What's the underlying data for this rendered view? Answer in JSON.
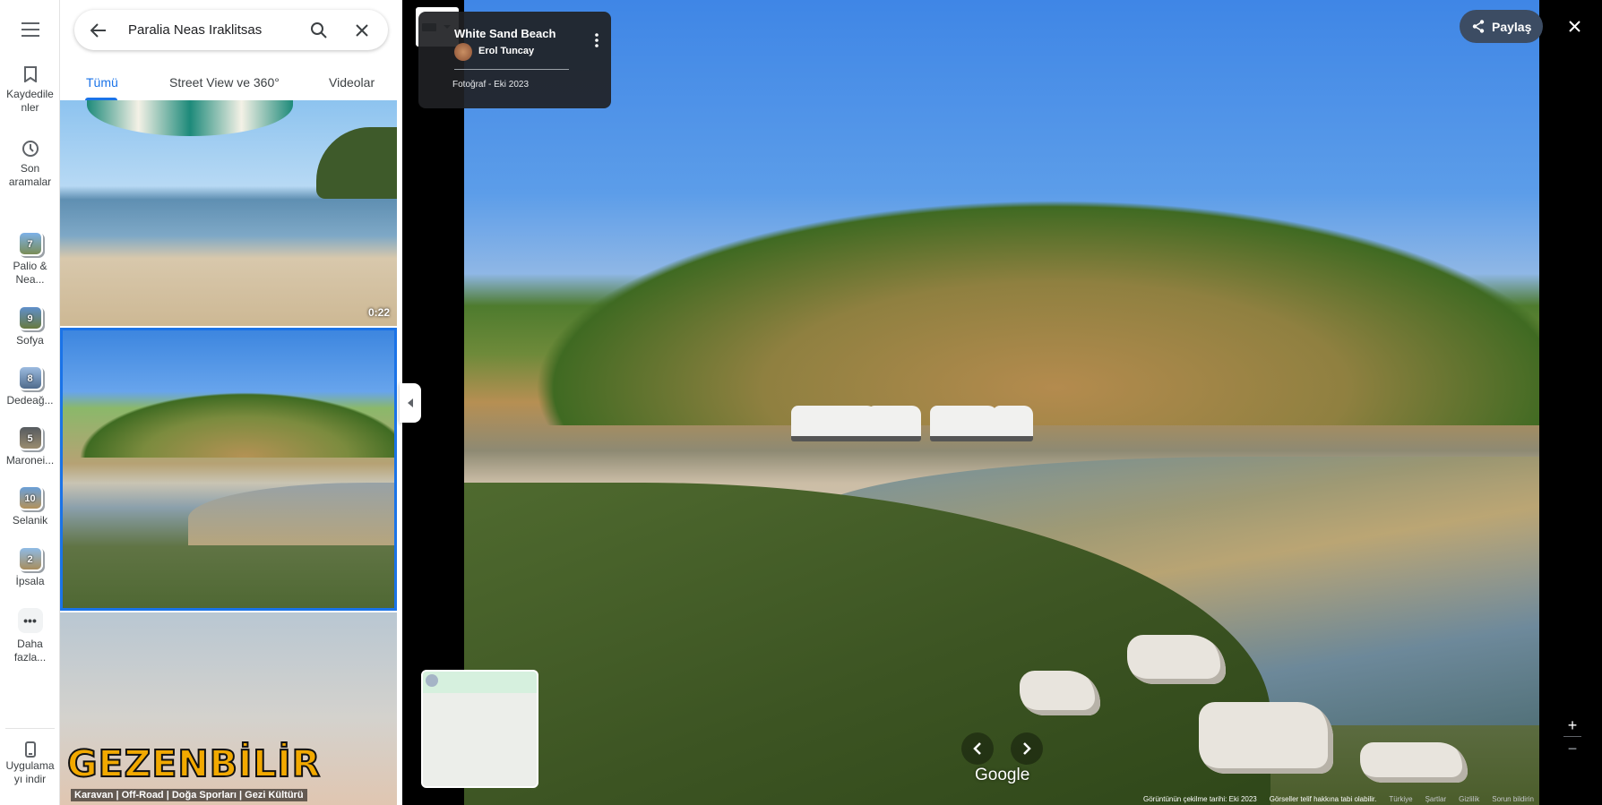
{
  "rail": {
    "saved_label": "Kaydedile\nnler",
    "recent_label": "Son\naramalar",
    "recent_places": [
      {
        "count": "7",
        "label": "Palio &\nNea..."
      },
      {
        "count": "9",
        "label": "Sofya"
      },
      {
        "count": "8",
        "label": "Dedeağ..."
      },
      {
        "count": "5",
        "label": "Maronei..."
      },
      {
        "count": "10",
        "label": "Selanik"
      },
      {
        "count": "2",
        "label": "İpsala"
      }
    ],
    "more_label": "Daha\nfazla...",
    "install_label": "Uygulama\nyı indir"
  },
  "search": {
    "value": "Paralia Neas Iraklitsas"
  },
  "tabs": [
    {
      "label": "Tümü"
    },
    {
      "label": "Street View ve 360°"
    },
    {
      "label": "Videolar"
    }
  ],
  "gallery": {
    "video_duration": "0:22",
    "brand_text": "GEZENBİLİR",
    "brand_subtext": "Karavan | Off-Road | Doğa Sporları | Gezi Kültürü"
  },
  "photo_card": {
    "title": "White Sand Beach",
    "author": "Erol Tuncay",
    "meta": "Fotoğraf - Eki 2023"
  },
  "toolbar": {
    "share_label": "Paylaş"
  },
  "viewer": {
    "brand": "Google"
  },
  "footer": {
    "capture_date": "Görüntünün çekilme tarihi: Eki 2023",
    "copyright": "Görseller telif hakkına tabi olabilir.",
    "region": "Türkiye",
    "terms": "Şartlar",
    "privacy": "Gizlilik",
    "report": "Sorun bildirin"
  },
  "colors": {
    "accent": "#1a73e8",
    "share_bg": "#3c4c63",
    "card_bg": "#202124"
  }
}
